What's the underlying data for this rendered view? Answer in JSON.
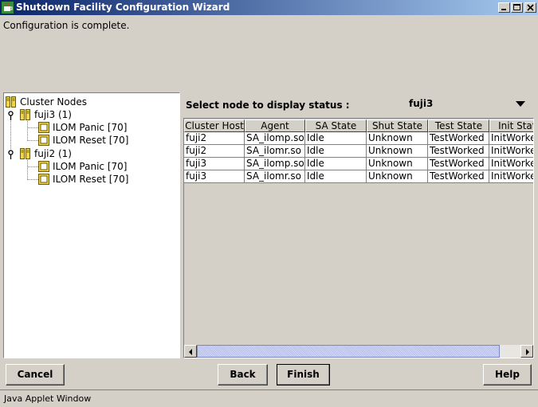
{
  "window": {
    "title": "Shutdown Facility Configuration Wizard",
    "icon": "java-cup-icon",
    "controls": [
      "minimize",
      "maximize",
      "close"
    ],
    "title_gradient": [
      "#0a246a",
      "#a6caf0"
    ]
  },
  "message": "Configuration is complete.",
  "tree": {
    "root_label": "Cluster Nodes",
    "nodes": [
      {
        "label": "fuji3 (1)",
        "children": [
          "ILOM Panic [70]",
          "ILOM Reset [70]"
        ]
      },
      {
        "label": "fuji2 (1)",
        "children": [
          "ILOM Panic [70]",
          "ILOM Reset [70]"
        ]
      }
    ]
  },
  "status_panel": {
    "select_label": "Select node to display status :",
    "selected_node": "fuji3",
    "columns": [
      "Cluster Host",
      "Agent",
      "SA State",
      "Shut State",
      "Test State",
      "Init State"
    ],
    "rows": [
      [
        "fuji2",
        "SA_ilomp.so",
        "Idle",
        "Unknown",
        "TestWorked",
        "InitWorked"
      ],
      [
        "fuji2",
        "SA_ilomr.so",
        "Idle",
        "Unknown",
        "TestWorked",
        "InitWorked"
      ],
      [
        "fuji3",
        "SA_ilomp.so",
        "Idle",
        "Unknown",
        "TestWorked",
        "InitWorked"
      ],
      [
        "fuji3",
        "SA_ilomr.so",
        "Idle",
        "Unknown",
        "TestWorked",
        "InitWorked"
      ]
    ]
  },
  "buttons": {
    "cancel": "Cancel",
    "back": "Back",
    "finish": "Finish",
    "help": "Help"
  },
  "status_bar": "Java Applet Window"
}
